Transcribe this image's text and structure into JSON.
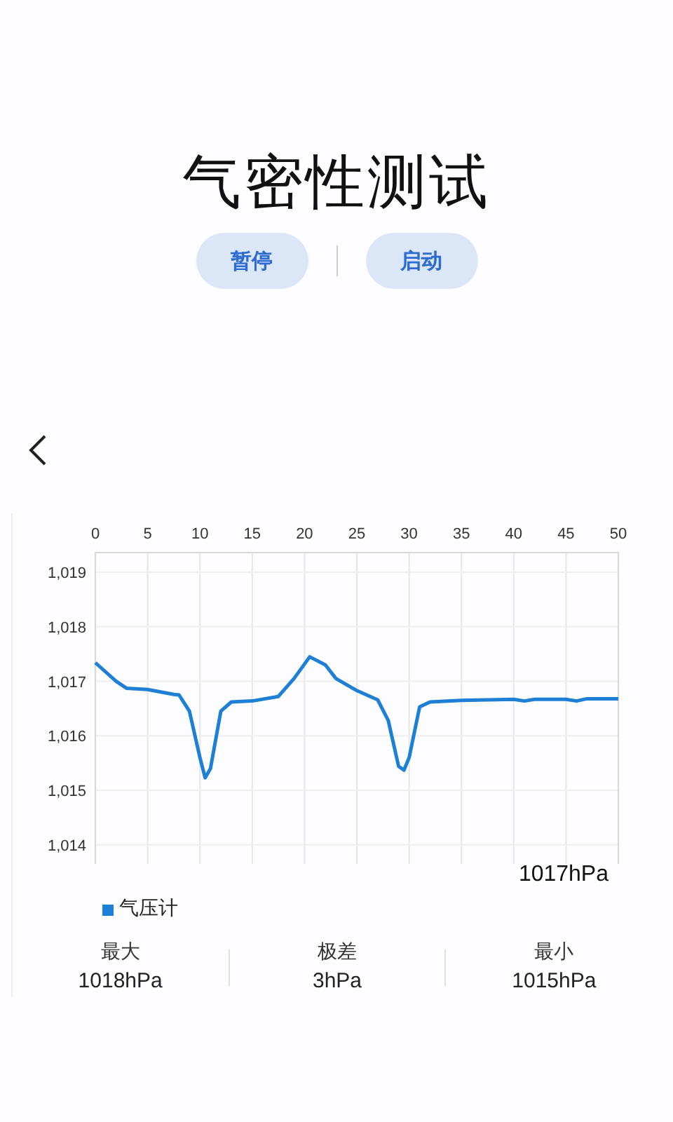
{
  "title": "气密性测试",
  "buttons": [
    {
      "label": "暂停"
    },
    {
      "label": "启动"
    }
  ],
  "chart": {
    "chart_data": {
      "type": "line",
      "x": [
        0,
        2,
        3,
        5,
        7.5,
        8,
        9,
        10,
        10.5,
        11,
        12,
        13,
        15,
        17.5,
        19,
        20.5,
        22,
        23,
        25,
        27,
        28,
        29,
        29.5,
        30,
        31,
        32,
        35,
        40,
        41,
        42,
        45,
        46,
        47,
        50
      ],
      "series": [
        {
          "name": "气压计",
          "color": "#1e7fd6",
          "values": [
            1017.34,
            1017.0,
            1016.87,
            1016.85,
            1016.76,
            1016.75,
            1016.45,
            1015.6,
            1015.23,
            1015.4,
            1016.45,
            1016.62,
            1016.64,
            1016.72,
            1017.05,
            1017.45,
            1017.3,
            1017.05,
            1016.83,
            1016.66,
            1016.28,
            1015.44,
            1015.37,
            1015.6,
            1016.53,
            1016.62,
            1016.65,
            1016.67,
            1016.64,
            1016.67,
            1016.67,
            1016.64,
            1016.68,
            1016.68
          ]
        }
      ],
      "grid": true,
      "xlim": [
        0,
        50
      ],
      "ylim": [
        1013.65,
        1019.36
      ],
      "xticks": [
        0,
        5,
        10,
        15,
        20,
        25,
        30,
        35,
        40,
        45,
        50
      ],
      "yticks": [
        {
          "value": 1019,
          "label": "1,019"
        },
        {
          "value": 1018,
          "label": "1,018"
        },
        {
          "value": 1017,
          "label": "1,017"
        },
        {
          "value": 1016,
          "label": "1,016"
        },
        {
          "value": 1015,
          "label": "1,015"
        },
        {
          "value": 1014,
          "label": "1,014"
        }
      ]
    },
    "current": "1017hPa"
  },
  "stats": [
    {
      "label": "最大",
      "value": "1018hPa"
    },
    {
      "label": "极差",
      "value": "3hPa"
    },
    {
      "label": "最小",
      "value": "1015hPa"
    }
  ]
}
